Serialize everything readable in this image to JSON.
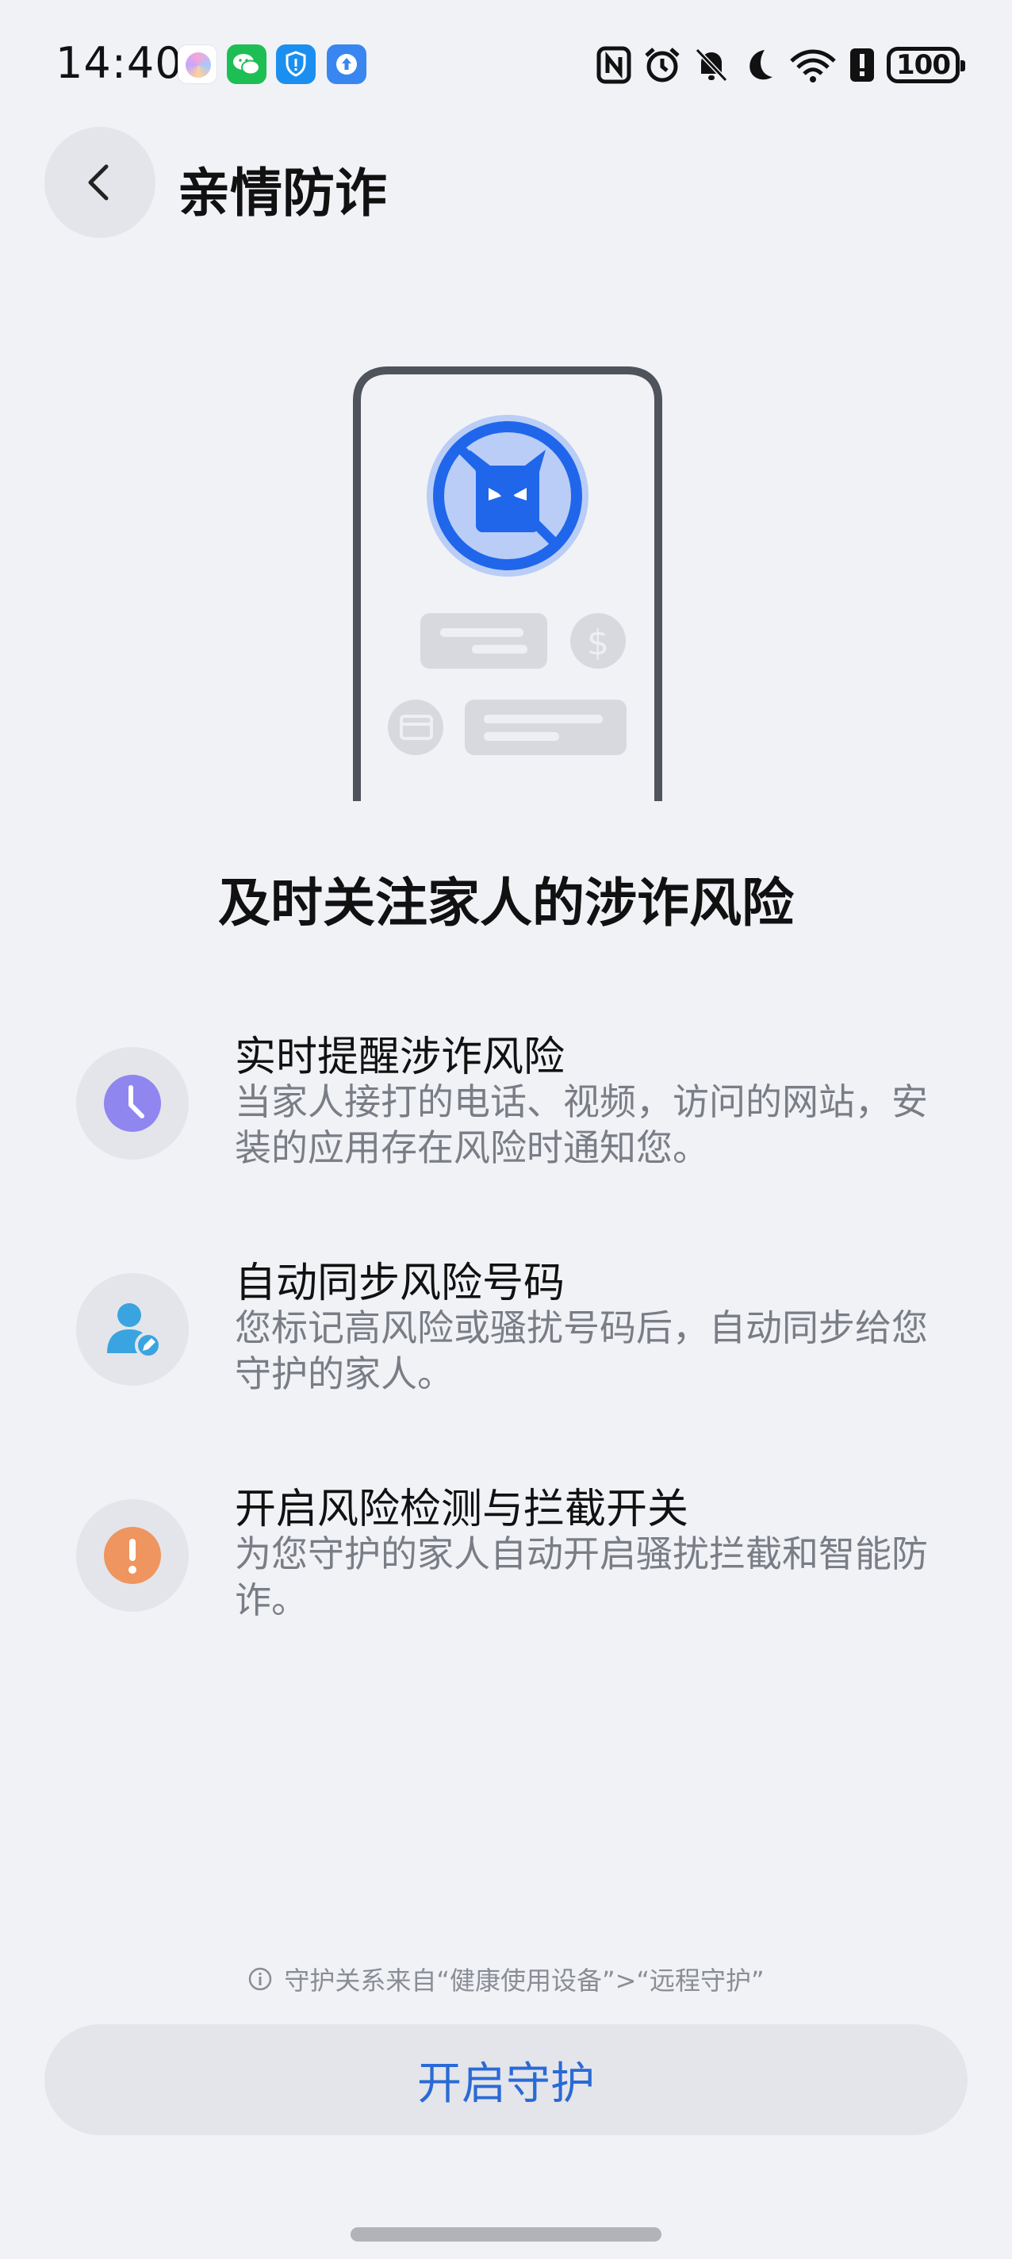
{
  "status_bar": {
    "time": "14:40",
    "battery": "100",
    "icons": [
      "app-notif-icon",
      "wechat-icon",
      "security-shield-icon",
      "upload-icon",
      "nfc-icon",
      "alarm-icon",
      "bell-off-icon",
      "moon-icon",
      "wifi-icon",
      "alert-icon",
      "battery-icon"
    ]
  },
  "header": {
    "title": "亲情防诈"
  },
  "hero": {
    "title": "及时关注家人的涉诈风险"
  },
  "features": [
    {
      "title": "实时提醒涉诈风险",
      "desc": "当家人接打的电话、视频，访问的网站，安装的应用存在风险时通知您。",
      "icon": "clock-icon",
      "color": "#8f86f0"
    },
    {
      "title": "自动同步风险号码",
      "desc": "您标记高风险或骚扰号码后，自动同步给您守护的家人。",
      "icon": "user-sync-icon",
      "color": "#3aa4e0"
    },
    {
      "title": "开启风险检测与拦截开关",
      "desc": "为您守护的家人自动开启骚扰拦截和智能防诈。",
      "icon": "exclamation-icon",
      "color": "#ef9560"
    }
  ],
  "footer": {
    "note": "守护关系来自“健康使用设备”>“远程守护”",
    "button": "开启守护"
  },
  "colors": {
    "accent": "#2a6ad6",
    "background": "#f1f2f6"
  }
}
